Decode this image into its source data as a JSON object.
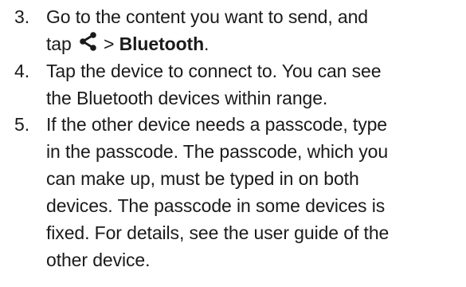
{
  "steps": [
    {
      "number": "3.",
      "line1": "Go to the content you want to send, and",
      "line2_prefix": "tap",
      "icon": "share-icon",
      "separator": ">",
      "bold_target": "Bluetooth",
      "end_punct": "."
    },
    {
      "number": "4.",
      "lines": [
        "Tap the device to connect to. You can see",
        "the Bluetooth devices within range."
      ]
    },
    {
      "number": "5.",
      "lines": [
        "If the other device needs a passcode, type",
        "in the passcode. The passcode, which you",
        "can make up, must be typed in on both",
        "devices. The passcode in some devices is",
        "fixed. For details, see the user guide of the",
        "other device."
      ]
    }
  ]
}
